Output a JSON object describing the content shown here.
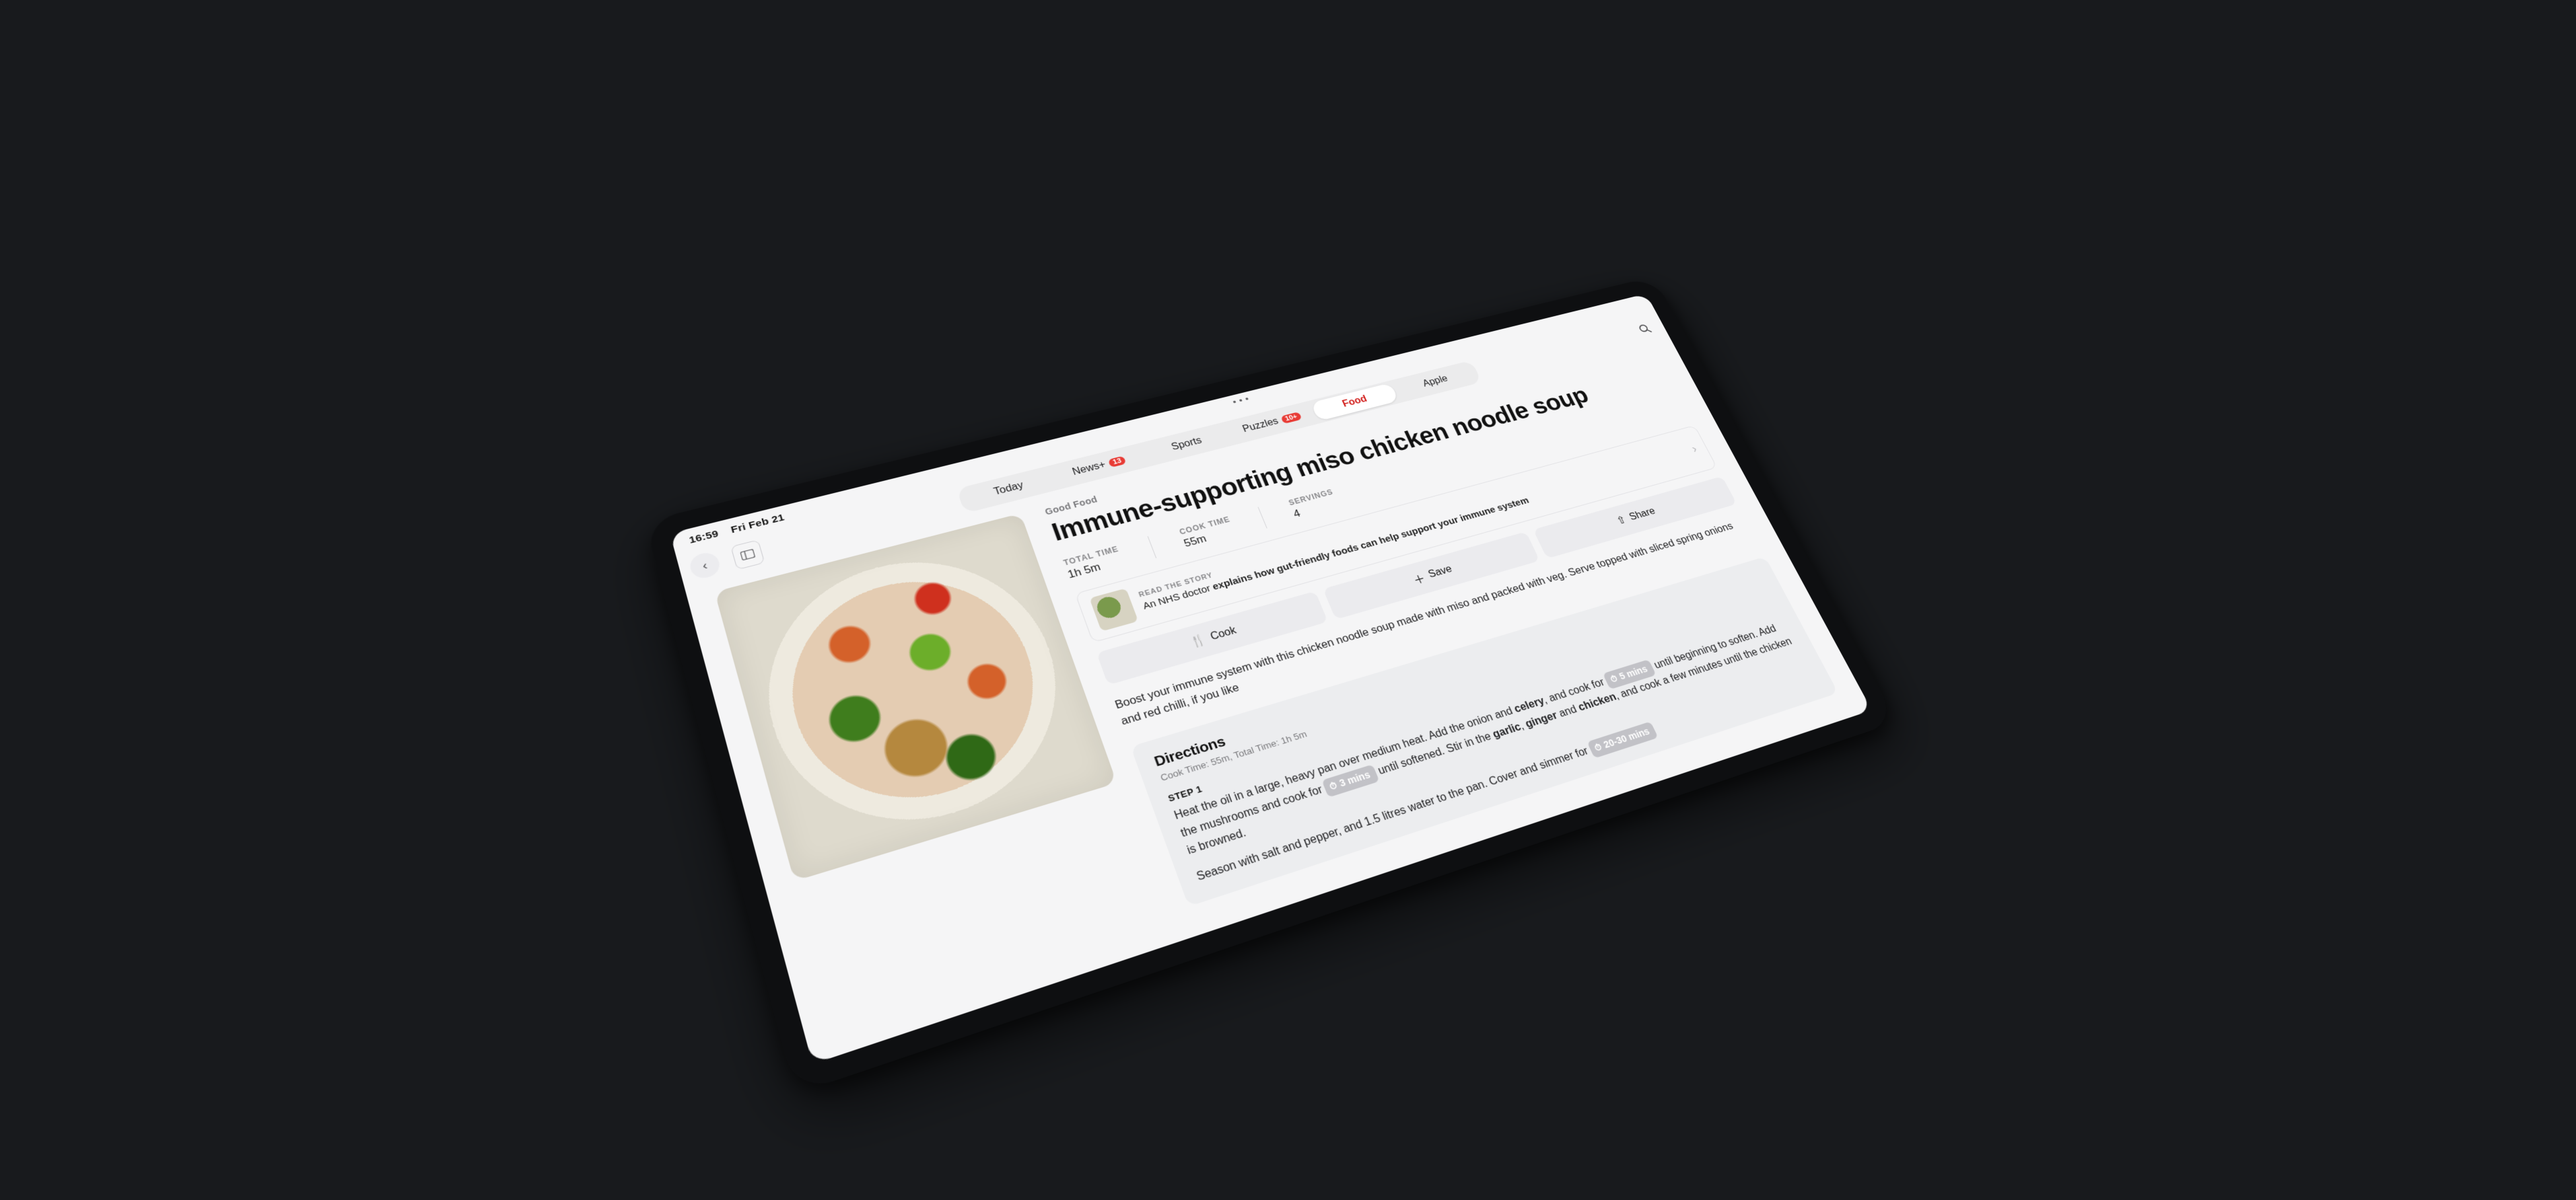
{
  "status": {
    "time": "16:59",
    "date": "Fri Feb 21"
  },
  "tabs": {
    "today": "Today",
    "newsplus": "News+",
    "newsplus_badge": "13",
    "sports": "Sports",
    "puzzles": "Puzzles",
    "puzzles_badge": "10+",
    "food": "Food",
    "apple": "Apple"
  },
  "article": {
    "kicker": "Good Food",
    "title": "Immune-supporting miso chicken noodle soup",
    "meta": {
      "total_label": "TOTAL TIME",
      "total_value": "1h 5m",
      "cook_label": "COOK TIME",
      "cook_value": "55m",
      "servings_label": "SERVINGS",
      "servings_value": "4"
    },
    "story": {
      "label": "READ THE STORY",
      "pre": "An NHS doctor ",
      "bold": "explains how gut-friendly foods can help support your immune system"
    },
    "actions": {
      "cook": "Cook",
      "save": "Save",
      "share": "Share"
    },
    "dek": "Boost your immune system with this chicken noodle soup made with miso and packed with veg. Serve topped with sliced spring onions and red chilli, if you like"
  },
  "directions": {
    "heading": "Directions",
    "subline": "Cook Time: 55m, Total Time: 1h 5m",
    "step1_label": "STEP 1",
    "step1_a": "Heat the oil in a large, heavy pan over medium heat. Add the onion and ",
    "step1_b": "celery",
    "step1_c": ", and cook for ",
    "chip1": "5 mins",
    "step1_d": " until beginning to soften. Add the mushrooms and cook for ",
    "chip2": "3 mins",
    "step1_e": " until softened. Stir in the ",
    "step1_f": "garlic",
    "step1_g": ", ",
    "step1_h": "ginger",
    "step1_i": " and ",
    "step1_j": "chicken",
    "step1_k": ", and cook a few minutes until the chicken is browned.",
    "step1_l": "Season with salt and pepper, and 1.5 litres water to the pan. Cover and simmer for ",
    "chip3": "20-30 mins"
  }
}
